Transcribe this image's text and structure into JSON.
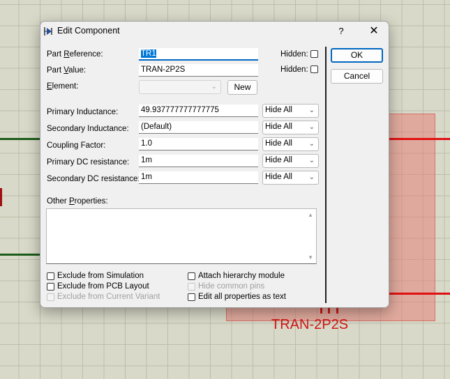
{
  "schematic": {
    "component_label": "TRAN-2P2S"
  },
  "dialog": {
    "title": "Edit Component",
    "help_label": "?",
    "close_label": "✕",
    "part_reference_label_pre": "Part ",
    "part_reference_label_u": "R",
    "part_reference_label_post": "eference:",
    "part_reference_value": "TR1",
    "part_value_label_pre": "Part ",
    "part_value_label_u": "V",
    "part_value_label_post": "alue:",
    "part_value_value": "TRAN-2P2S",
    "element_label_u": "E",
    "element_label_post": "lement:",
    "element_value": "",
    "new_button": "New",
    "hidden_label": "Hidden:",
    "ok_button": "OK",
    "cancel_button": "Cancel",
    "properties": [
      {
        "label": "Primary Inductance:",
        "value": "49.937777777777775",
        "visibility": "Hide All"
      },
      {
        "label": "Secondary Inductance:",
        "value": "(Default)",
        "visibility": "Hide All"
      },
      {
        "label": "Coupling Factor:",
        "value": "1.0",
        "visibility": "Hide All"
      },
      {
        "label": "Primary DC resistance:",
        "value": "1m",
        "visibility": "Hide All"
      },
      {
        "label": "Secondary DC resistance:",
        "value": "1m",
        "visibility": "Hide All"
      }
    ],
    "other_properties_label_pre": "Other ",
    "other_properties_label_u": "P",
    "other_properties_label_post": "roperties:",
    "other_properties_value": "",
    "checkboxes": {
      "exclude_simulation": {
        "label": "Exclude from Simulation",
        "checked": false,
        "enabled": true
      },
      "exclude_pcb": {
        "label": "Exclude from PCB Layout",
        "checked": false,
        "enabled": true
      },
      "exclude_variant": {
        "label": "Exclude from Current Variant",
        "checked": false,
        "enabled": false
      },
      "attach_hierarchy": {
        "label": "Attach hierarchy module",
        "checked": false,
        "enabled": true
      },
      "hide_common_pins": {
        "label": "Hide common pins",
        "checked": false,
        "enabled": false
      },
      "edit_as_text": {
        "label": "Edit all properties as text",
        "checked": false,
        "enabled": true
      }
    }
  }
}
